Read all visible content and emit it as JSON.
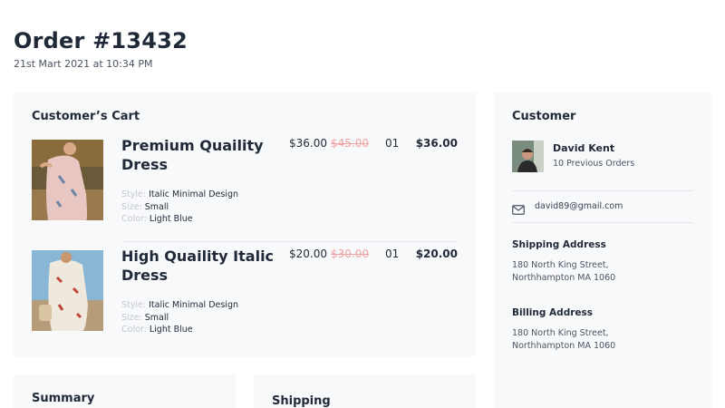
{
  "order": {
    "title": "Order #13432",
    "date": "21st Mart 2021 at 10:34 PM"
  },
  "cart": {
    "heading": "Customer’s Cart",
    "items": [
      {
        "name": "Premium Quaility Dress",
        "price": "$36.00",
        "old_price": "$45.00",
        "qty": "01",
        "total": "$36.00",
        "style_label": "Style:",
        "style": "Italic Minimal Design",
        "size_label": "Size:",
        "size": "Small",
        "color_label": "Color:",
        "color": "Light Blue"
      },
      {
        "name": "High Quaility Italic Dress",
        "price": "$20.00",
        "old_price": "$30.00",
        "qty": "01",
        "total": "$20.00",
        "style_label": "Style:",
        "style": "Italic Minimal Design",
        "size_label": "Size:",
        "size": "Small",
        "color_label": "Color:",
        "color": "Light Blue"
      }
    ]
  },
  "customer": {
    "heading": "Customer",
    "name": "David Kent",
    "orders": "10 Previous Orders",
    "email": "david89@gmail.com",
    "shipping_title": "Shipping Address",
    "shipping_line1": "180 North King Street,",
    "shipping_line2": "Northhampton MA 1060",
    "billing_title": "Billing Address",
    "billing_line1": "180 North King Street,",
    "billing_line2": "Northhampton MA 1060"
  },
  "summary": {
    "heading": "Summary"
  },
  "shipping": {
    "heading": "Shipping"
  },
  "icons": {
    "email": "mail-icon"
  },
  "colors": {
    "panel_bg": "#f8f9fb",
    "old_price": "#f0a3a3",
    "text": "#1f2937"
  }
}
